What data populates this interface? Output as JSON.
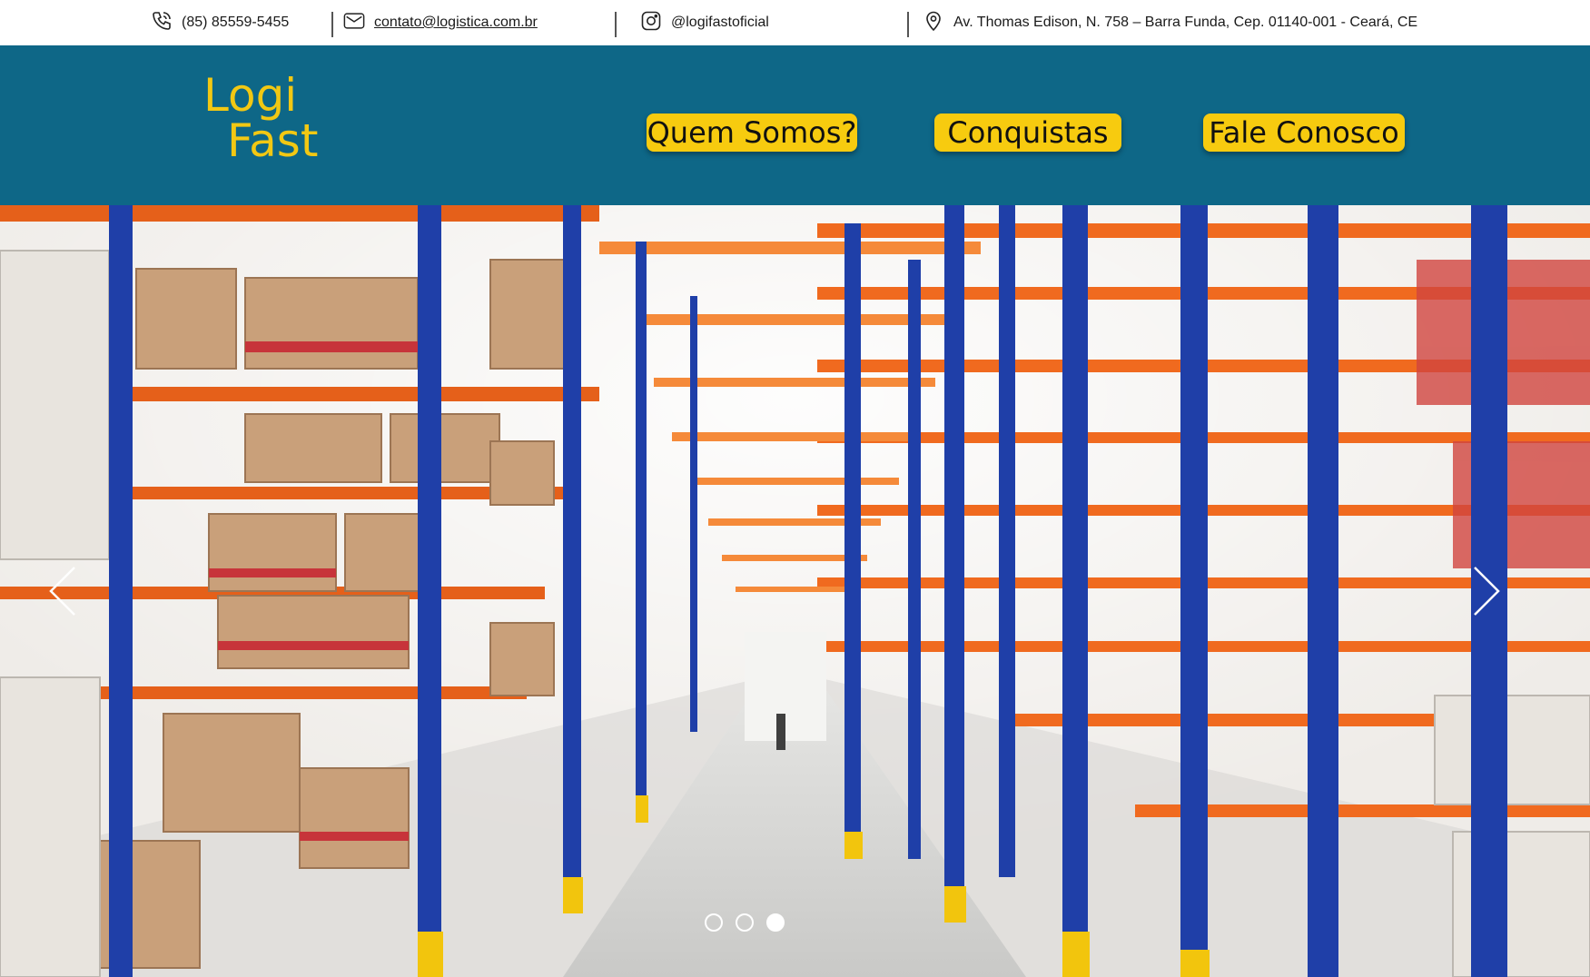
{
  "contact": {
    "phone": "(85) 85559-5455",
    "email": "contato@logistica.com.br",
    "instagram": "@logifastoficial",
    "address": "Av. Thomas Edison, N. 758 – Barra Funda, Cep. 01140-001 - Ceará, CE"
  },
  "icons": {
    "phone": "phone-icon",
    "email": "mail-icon",
    "instagram": "instagram-icon",
    "address": "location-pin-icon",
    "prev": "chevron-left-icon",
    "next": "chevron-right-icon"
  },
  "logo": {
    "line1": "Logi",
    "line2": "Fast"
  },
  "nav": {
    "about": "Quem Somos?",
    "achievements": "Conquistas",
    "contact": "Fale Conosco"
  },
  "carousel": {
    "slide_count": 3,
    "active_index": 2
  },
  "colors": {
    "header_bg": "#0e6787",
    "accent_yellow": "#f7cb0f",
    "logo_yellow": "#f2c813",
    "rack_blue": "#1f3fa8",
    "beam_orange": "#f06a1f"
  }
}
